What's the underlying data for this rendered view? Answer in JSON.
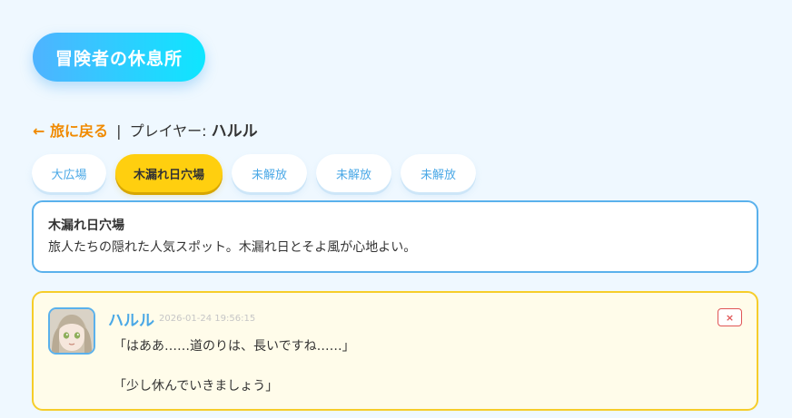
{
  "header": {
    "title": "冒険者の休息所"
  },
  "nav": {
    "back_label": "← 旅に戻る",
    "separator": "|",
    "player_prefix": "プレイヤー:",
    "player_name": "ハルル"
  },
  "tabs": [
    {
      "label": "大広場",
      "active": false
    },
    {
      "label": "木漏れ日穴場",
      "active": true
    },
    {
      "label": "未解放",
      "active": false
    },
    {
      "label": "未解放",
      "active": false
    },
    {
      "label": "未解放",
      "active": false
    }
  ],
  "location": {
    "title": "木漏れ日穴場",
    "description": "旅人たちの隠れた人気スポット。木漏れ日とそよ風が心地よい。"
  },
  "message": {
    "author": "ハルル",
    "timestamp": "2026-01-24 19:56:15",
    "lines": [
      "「はああ……道のりは、長いですね……」",
      "「少し休んでいきましょう」"
    ],
    "delete_label": "×"
  },
  "colors": {
    "accent_blue": "#4aa8e6",
    "active_tab": "#ffcf0f",
    "back_link": "#f08a00",
    "delete": "#e05555"
  }
}
